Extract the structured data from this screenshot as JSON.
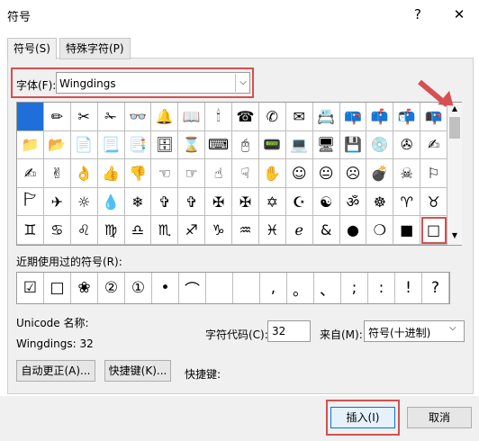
{
  "title": "符号",
  "titlebar": {
    "help": "?",
    "close": "✕"
  },
  "tabs": [
    {
      "label": "符号(S)"
    },
    {
      "label": "特殊字符(P)"
    }
  ],
  "font": {
    "label": "字体(F):",
    "value": "Wingdings",
    "dropdown": "⌵"
  },
  "grid_rows": [
    [
      "",
      "✏",
      "✂",
      "✁",
      "👓",
      "🔔",
      "📖",
      "🕯",
      "☎",
      "✆",
      "✉",
      "📇",
      "📪",
      "📫",
      "📬",
      "📭"
    ],
    [
      "📁",
      "📂",
      "📄",
      "📃",
      "📑",
      "🗄",
      "⌛",
      "⌨",
      "🖰",
      "📟",
      "💻",
      "🖥",
      "💾",
      "💿",
      "✇",
      "✍"
    ],
    [
      "✍",
      "✌",
      "👌",
      "👍",
      "👎",
      "☜",
      "☞",
      "☝",
      "☟",
      "✋",
      "☺",
      "😐",
      "☹",
      "💣",
      "☠",
      "⚐"
    ],
    [
      "🏱",
      "✈",
      "☼",
      "💧",
      "❄",
      "✞",
      "✞",
      "✠",
      "✠",
      "✡",
      "☪",
      "☯",
      "ॐ",
      "☸",
      "♈",
      "♉"
    ],
    [
      "♊",
      "♋",
      "♌",
      "♍",
      "♎",
      "♏",
      "♐",
      "♑",
      "♒",
      "♓",
      "ℯ",
      "&",
      "●",
      "❍",
      "■",
      "□"
    ]
  ],
  "scroll": {
    "up": "▲",
    "down": "▼"
  },
  "recent": {
    "label": "近期使用过的符号(R):",
    "items": [
      "☑",
      "□",
      "❀",
      "②",
      "①",
      "•",
      "⌒",
      "",
      "",
      ",",
      "。",
      "、",
      ";",
      ":",
      "!",
      "?"
    ]
  },
  "unicode_name_label": "Unicode 名称:",
  "font_code_label": "Wingdings: 32",
  "charcode": {
    "label": "字符代码(C):",
    "value": "32"
  },
  "from": {
    "label": "来自(M):",
    "value": "符号(十进制)",
    "arrow": "⌵"
  },
  "buttons": {
    "autocorrect": "自动更正(A)...",
    "shortcut": "快捷键(K)...",
    "shortcut_label": "快捷键:",
    "insert": "插入(I)",
    "cancel": "取消"
  },
  "colors": {
    "highlight": "#d65050",
    "selection": "#1e6fd9"
  }
}
